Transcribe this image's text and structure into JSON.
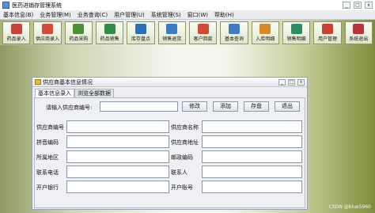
{
  "window": {
    "title": "医药进销存管理系统"
  },
  "menubar": {
    "items": [
      "基本信息(B)",
      "业务管理(M)",
      "业务查询(C)",
      "用户管理(U)",
      "系统管理(S)",
      "窗口(W)",
      "帮助(H)"
    ]
  },
  "toolbar": {
    "buttons": [
      {
        "label": "药品录入",
        "icon": "pill-box-icon",
        "color": "#c9423a"
      },
      {
        "label": "供应商录入",
        "icon": "supplier-icon",
        "color": "#d24c3e"
      },
      {
        "label": "药品采购",
        "icon": "purchase-icon",
        "color": "#4e8f3a"
      },
      {
        "label": "药品销售",
        "icon": "sale-icon",
        "color": "#2f8d47"
      },
      {
        "label": "库存盘点",
        "icon": "inventory-icon",
        "color": "#2c6fb5"
      },
      {
        "label": "销售退货",
        "icon": "sales-return-icon",
        "color": "#3b7cc2"
      },
      {
        "label": "客户回款",
        "icon": "payment-icon",
        "color": "#cf4a34"
      },
      {
        "label": "基本查询",
        "icon": "search-icon",
        "color": "#3f7ac3"
      },
      {
        "label": "入库明细",
        "icon": "stock-in-icon",
        "color": "#d68a2b"
      },
      {
        "label": "销售明细",
        "icon": "sales-detail-icon",
        "color": "#2c8c6a"
      },
      {
        "label": "用户管理",
        "icon": "user-icon",
        "color": "#c8402f"
      },
      {
        "label": "系统退出",
        "icon": "exit-icon",
        "color": "#b8333a"
      }
    ]
  },
  "panel": {
    "title": "供应商基本信息情况",
    "controls": [
      "_",
      "□",
      "x"
    ],
    "tabs": [
      {
        "label": "基本信息录入",
        "active": true
      },
      {
        "label": "浏览全部数据",
        "active": false
      }
    ],
    "query": {
      "label": "请输入供应商编号:",
      "value": ""
    },
    "actions": [
      "修改",
      "添加",
      "存盘",
      "退出"
    ],
    "fields": [
      {
        "label": "供应商编号",
        "value": ""
      },
      {
        "label": "供应商名称",
        "value": ""
      },
      {
        "label": "拼音编码",
        "value": ""
      },
      {
        "label": "供应商地址",
        "value": ""
      },
      {
        "label": "所属地区",
        "value": ""
      },
      {
        "label": "邮政编码",
        "value": ""
      },
      {
        "label": "联系电话",
        "value": ""
      },
      {
        "label": "联系人",
        "value": ""
      },
      {
        "label": "开户银行",
        "value": ""
      },
      {
        "label": "开户账号",
        "value": ""
      }
    ]
  },
  "watermark": "CSDN @blue5960"
}
